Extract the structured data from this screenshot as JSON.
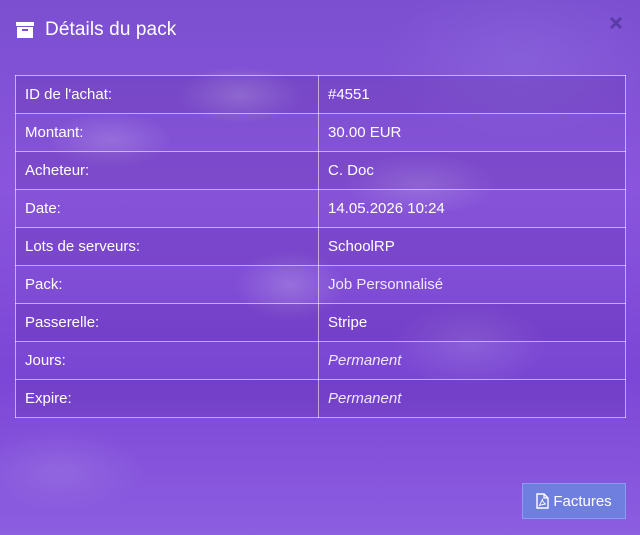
{
  "modal": {
    "title": "Détails du pack",
    "title_icon": "archive-box-icon",
    "close_icon": "close-icon"
  },
  "details": {
    "rows": [
      {
        "label": "ID de l'achat:",
        "value": "#4551"
      },
      {
        "label": "Montant:",
        "value": "30.00 EUR"
      },
      {
        "label": "Acheteur:",
        "value": "C. Doc"
      },
      {
        "label": "Date:",
        "value": "14.05.2026 10:24"
      },
      {
        "label": "Lots de serveurs:",
        "value": "SchoolRP"
      },
      {
        "label": "Pack:",
        "value": "Job Personnalisé"
      },
      {
        "label": "Passerelle:",
        "value": "Stripe"
      },
      {
        "label": "Jours:",
        "value": "Permanent"
      },
      {
        "label": "Expire:",
        "value": "Permanent"
      }
    ]
  },
  "footer": {
    "invoices_label": "Factures",
    "invoices_icon": "pdf-file-icon"
  },
  "colors": {
    "background": "#8150d8",
    "button": "#6f7fe0"
  }
}
